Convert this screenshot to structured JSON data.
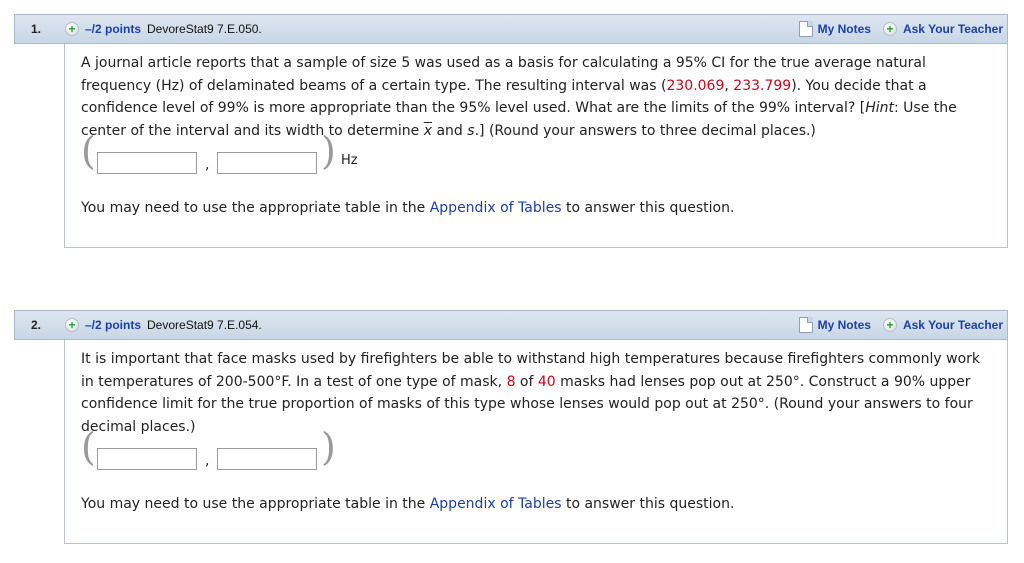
{
  "questions": [
    {
      "number": "1.",
      "points": "–/2 points",
      "code": "DevoreStat9 7.E.050.",
      "my_notes": "My Notes",
      "ask_teacher": "Ask Your Teacher",
      "text_a": "A journal article reports that a sample of size 5 was used as a basis for calculating a 95% CI for the true average natural frequency (Hz) of delaminated beams of a certain type. The resulting interval was (",
      "red_1": "230.069",
      "text_b": ", ",
      "red_2": "233.799",
      "text_c": "). You decide that a confidence level of 99% is more appropriate than the 95% level used. What are the limits of the 99% interval? [",
      "hint": "Hint",
      "text_d": ": Use the center of the interval and its width to determine ",
      "xbar": "x",
      "text_e": " and ",
      "s": "s",
      "text_f": ".] (Round your answers to three decimal places.)",
      "input_1": "",
      "input_2": "",
      "unit": "Hz",
      "appendix_before": "You may need to use the appropriate table in the ",
      "appendix_link": "Appendix of Tables",
      "appendix_after": " to answer this question."
    },
    {
      "number": "2.",
      "points": "–/2 points",
      "code": "DevoreStat9 7.E.054.",
      "my_notes": "My Notes",
      "ask_teacher": "Ask Your Teacher",
      "text_a": "It is important that face masks used by firefighters be able to withstand high temperatures because firefighters commonly work in temperatures of 200-500°F. In a test of one type of mask, ",
      "red_1": "8",
      "text_b": " of ",
      "red_2": "40",
      "text_c": " masks had lenses pop out at 250°. Construct a 90% upper confidence limit for the true proportion of masks of this type whose lenses would pop out at 250°. (Round your answers to four decimal places.)",
      "input_1": "",
      "input_2": "",
      "appendix_before": "You may need to use the appropriate table in the ",
      "appendix_link": "Appendix of Tables",
      "appendix_after": " to answer this question."
    }
  ],
  "colors": {
    "link": "#1b3fa8",
    "red_value": "#d0021b",
    "header_bg": "#c8d6e6"
  },
  "icons": {
    "plus": "plus-circle-icon",
    "notes": "note-icon"
  }
}
